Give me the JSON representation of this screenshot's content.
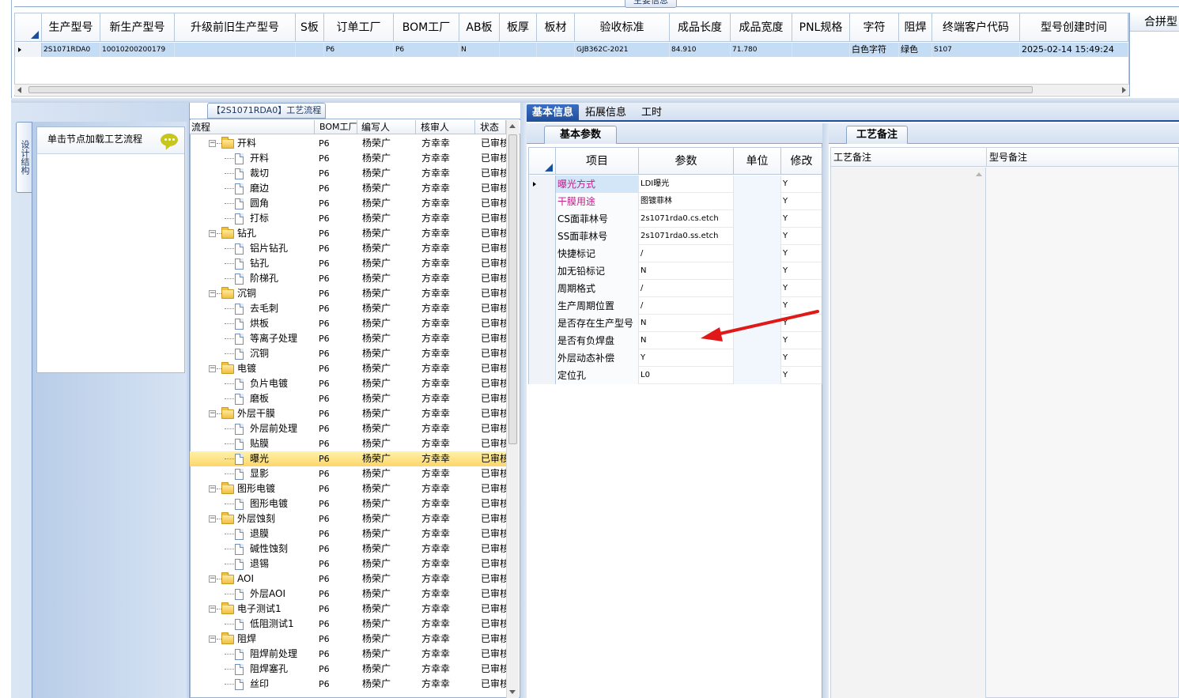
{
  "top": {
    "tab_label": "主要信息",
    "columns": [
      "生产型号",
      "新生产型号",
      "升级前旧生产型号",
      "S板",
      "订单工厂",
      "BOM工厂",
      "AB板",
      "板厚",
      "板材",
      "验收标准",
      "成品长度",
      "成品宽度",
      "PNL规格",
      "字符",
      "阻焊",
      "终端客户代码",
      "型号创建时间"
    ],
    "row": [
      "2S1071RDA0",
      "10010200200179",
      "",
      "",
      "P6",
      "P6",
      "N",
      "",
      "",
      "GJB362C-2021",
      "84.910",
      "71.780",
      "",
      "白色字符",
      "绿色",
      "S107",
      "2025-02-14 15:49:24"
    ],
    "side_title": "合拼型"
  },
  "left": {
    "vertical_tab": "设计结构",
    "tip_text": "单击节点加载工艺流程"
  },
  "tree": {
    "title": "【2S1071RDA0】工艺流程",
    "columns": [
      "流程",
      "BOM工厂",
      "编写人",
      "核审人",
      "状态"
    ],
    "rows": [
      {
        "name": "开料",
        "folder": true,
        "factory": "P6",
        "writer": "杨荣广",
        "reviewer": "方幸幸",
        "status": "已审核"
      },
      {
        "name": "开料",
        "folder": false,
        "factory": "P6",
        "writer": "杨荣广",
        "reviewer": "方幸幸",
        "status": "已审核"
      },
      {
        "name": "裁切",
        "folder": false,
        "factory": "P6",
        "writer": "杨荣广",
        "reviewer": "方幸幸",
        "status": "已审核"
      },
      {
        "name": "磨边",
        "folder": false,
        "factory": "P6",
        "writer": "杨荣广",
        "reviewer": "方幸幸",
        "status": "已审核"
      },
      {
        "name": "圆角",
        "folder": false,
        "factory": "P6",
        "writer": "杨荣广",
        "reviewer": "方幸幸",
        "status": "已审核"
      },
      {
        "name": "打标",
        "folder": false,
        "factory": "P6",
        "writer": "杨荣广",
        "reviewer": "方幸幸",
        "status": "已审核"
      },
      {
        "name": "钻孔",
        "folder": true,
        "factory": "P6",
        "writer": "杨荣广",
        "reviewer": "方幸幸",
        "status": "已审核"
      },
      {
        "name": "铝片钻孔",
        "folder": false,
        "factory": "P6",
        "writer": "杨荣广",
        "reviewer": "方幸幸",
        "status": "已审核"
      },
      {
        "name": "钻孔",
        "folder": false,
        "factory": "P6",
        "writer": "杨荣广",
        "reviewer": "方幸幸",
        "status": "已审核"
      },
      {
        "name": "阶梯孔",
        "folder": false,
        "factory": "P6",
        "writer": "杨荣广",
        "reviewer": "方幸幸",
        "status": "已审核"
      },
      {
        "name": "沉铜",
        "folder": true,
        "factory": "P6",
        "writer": "杨荣广",
        "reviewer": "方幸幸",
        "status": "已审核"
      },
      {
        "name": "去毛刺",
        "folder": false,
        "factory": "P6",
        "writer": "杨荣广",
        "reviewer": "方幸幸",
        "status": "已审核"
      },
      {
        "name": "烘板",
        "folder": false,
        "factory": "P6",
        "writer": "杨荣广",
        "reviewer": "方幸幸",
        "status": "已审核"
      },
      {
        "name": "等离子处理",
        "folder": false,
        "factory": "P6",
        "writer": "杨荣广",
        "reviewer": "方幸幸",
        "status": "已审核"
      },
      {
        "name": "沉铜",
        "folder": false,
        "factory": "P6",
        "writer": "杨荣广",
        "reviewer": "方幸幸",
        "status": "已审核"
      },
      {
        "name": "电镀",
        "folder": true,
        "factory": "P6",
        "writer": "杨荣广",
        "reviewer": "方幸幸",
        "status": "已审核"
      },
      {
        "name": "负片电镀",
        "folder": false,
        "factory": "P6",
        "writer": "杨荣广",
        "reviewer": "方幸幸",
        "status": "已审核"
      },
      {
        "name": "磨板",
        "folder": false,
        "factory": "P6",
        "writer": "杨荣广",
        "reviewer": "方幸幸",
        "status": "已审核"
      },
      {
        "name": "外层干膜",
        "folder": true,
        "factory": "P6",
        "writer": "杨荣广",
        "reviewer": "方幸幸",
        "status": "已审核"
      },
      {
        "name": "外层前处理",
        "folder": false,
        "factory": "P6",
        "writer": "杨荣广",
        "reviewer": "方幸幸",
        "status": "已审核"
      },
      {
        "name": "贴膜",
        "folder": false,
        "factory": "P6",
        "writer": "杨荣广",
        "reviewer": "方幸幸",
        "status": "已审核"
      },
      {
        "name": "曝光",
        "folder": false,
        "factory": "P6",
        "writer": "杨荣广",
        "reviewer": "方幸幸",
        "status": "已审核",
        "selected": true
      },
      {
        "name": "显影",
        "folder": false,
        "factory": "P6",
        "writer": "杨荣广",
        "reviewer": "方幸幸",
        "status": "已审核"
      },
      {
        "name": "图形电镀",
        "folder": true,
        "factory": "P6",
        "writer": "杨荣广",
        "reviewer": "方幸幸",
        "status": "已审核"
      },
      {
        "name": "图形电镀",
        "folder": false,
        "factory": "P6",
        "writer": "杨荣广",
        "reviewer": "方幸幸",
        "status": "已审核"
      },
      {
        "name": "外层蚀刻",
        "folder": true,
        "factory": "P6",
        "writer": "杨荣广",
        "reviewer": "方幸幸",
        "status": "已审核"
      },
      {
        "name": "退膜",
        "folder": false,
        "factory": "P6",
        "writer": "杨荣广",
        "reviewer": "方幸幸",
        "status": "已审核"
      },
      {
        "name": "碱性蚀刻",
        "folder": false,
        "factory": "P6",
        "writer": "杨荣广",
        "reviewer": "方幸幸",
        "status": "已审核"
      },
      {
        "name": "退锡",
        "folder": false,
        "factory": "P6",
        "writer": "杨荣广",
        "reviewer": "方幸幸",
        "status": "已审核"
      },
      {
        "name": "AOI",
        "folder": true,
        "factory": "P6",
        "writer": "杨荣广",
        "reviewer": "方幸幸",
        "status": "已审核"
      },
      {
        "name": "外层AOI",
        "folder": false,
        "factory": "P6",
        "writer": "杨荣广",
        "reviewer": "方幸幸",
        "status": "已审核"
      },
      {
        "name": "电子测试1",
        "folder": true,
        "factory": "P6",
        "writer": "杨荣广",
        "reviewer": "方幸幸",
        "status": "已审核"
      },
      {
        "name": "低阻测试1",
        "folder": false,
        "factory": "P6",
        "writer": "杨荣广",
        "reviewer": "方幸幸",
        "status": "已审核"
      },
      {
        "name": "阻焊",
        "folder": true,
        "factory": "P6",
        "writer": "杨荣广",
        "reviewer": "方幸幸",
        "status": "已审核"
      },
      {
        "name": "阻焊前处理",
        "folder": false,
        "factory": "P6",
        "writer": "杨荣广",
        "reviewer": "方幸幸",
        "status": "已审核"
      },
      {
        "name": "阻焊塞孔",
        "folder": false,
        "factory": "P6",
        "writer": "杨荣广",
        "reviewer": "方幸幸",
        "status": "已审核"
      },
      {
        "name": "丝印",
        "folder": false,
        "factory": "P6",
        "writer": "杨荣广",
        "reviewer": "方幸幸",
        "status": "已审核"
      }
    ]
  },
  "info_tabs": [
    "基本信息",
    "拓展信息",
    "工时"
  ],
  "params": {
    "tab_label": "基本参数",
    "columns": [
      "项目",
      "参数",
      "单位",
      "修改"
    ],
    "rows": [
      {
        "item": "曝光方式",
        "value": "LDI曝光",
        "unit": "",
        "mod": "Y",
        "pink": true,
        "current": true
      },
      {
        "item": "干膜用途",
        "value": "图镀菲林",
        "unit": "",
        "mod": "Y",
        "pink": true
      },
      {
        "item": "CS面菲林号",
        "value": "2s1071rda0.cs.etch",
        "unit": "",
        "mod": "Y"
      },
      {
        "item": "SS面菲林号",
        "value": "2s1071rda0.ss.etch",
        "unit": "",
        "mod": "Y"
      },
      {
        "item": "快捷标记",
        "value": "/",
        "unit": "",
        "mod": "Y"
      },
      {
        "item": "加无铅标记",
        "value": "N",
        "unit": "",
        "mod": "Y"
      },
      {
        "item": "周期格式",
        "value": "/",
        "unit": "",
        "mod": "Y"
      },
      {
        "item": "生产周期位置",
        "value": "/",
        "unit": "",
        "mod": "Y"
      },
      {
        "item": "是否存在生产型号",
        "value": "N",
        "unit": "",
        "mod": "Y"
      },
      {
        "item": "是否有负焊盘",
        "value": "N",
        "unit": "",
        "mod": "Y"
      },
      {
        "item": "外层动态补偿",
        "value": "Y",
        "unit": "",
        "mod": "Y"
      },
      {
        "item": "定位孔",
        "value": "L0",
        "unit": "",
        "mod": "Y"
      }
    ]
  },
  "notes": {
    "tab_label": "工艺备注",
    "col1": "工艺备注",
    "col2": "型号备注"
  },
  "colors": {
    "accent": "#1f4e99",
    "selected_row": "#c5dcf5",
    "tree_selected": "#fcd66a",
    "pink_text": "#c0208a",
    "annotation_arrow": "#e01818"
  },
  "icons": [
    "folder-icon",
    "document-icon",
    "chat-bubble-icon",
    "expand-collapse-icon",
    "red-arrow-annotation"
  ]
}
